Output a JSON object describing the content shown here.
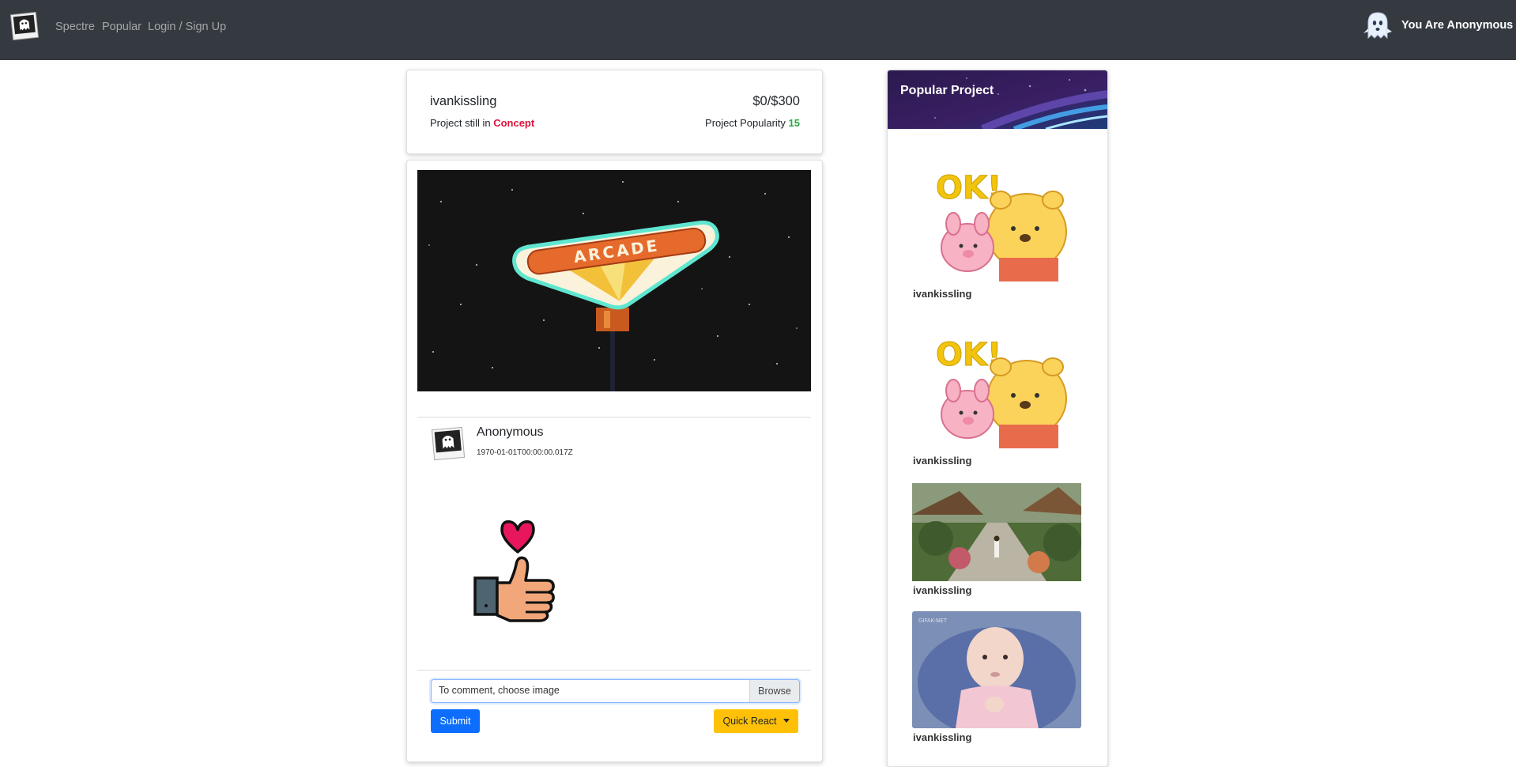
{
  "nav": {
    "links": [
      "Spectre",
      "Popular",
      "Login / Sign Up"
    ],
    "user": "You Are Anonymous"
  },
  "project": {
    "creator": "ivankissling",
    "funding": "$0/$300",
    "stage_prefix": "Project still in ",
    "stage": "Concept",
    "popularity_prefix": "Project Popularity ",
    "popularity": "15",
    "hero_sign_text": "ARCADE"
  },
  "comment": {
    "author": "Anonymous",
    "timestamp": "1970-01-01T00:00:00.017Z"
  },
  "form": {
    "file_placeholder": "To comment, choose image",
    "browse": "Browse",
    "submit": "Submit",
    "quick_react": "Quick React"
  },
  "sidebar": {
    "title": "Popular Project",
    "items": [
      {
        "name": "ivankissling",
        "image": "ok-bears-icon"
      },
      {
        "name": "ivankissling",
        "image": "ok-bears-icon"
      },
      {
        "name": "ivankissling",
        "image": "garden-path-photo"
      },
      {
        "name": "ivankissling",
        "image": "baby-photo"
      }
    ]
  },
  "colors": {
    "navbar": "#343a40",
    "stage": "#dc143c",
    "popularity": "#28a745",
    "submit": "#0d6efd",
    "quick_react": "#ffc107"
  }
}
